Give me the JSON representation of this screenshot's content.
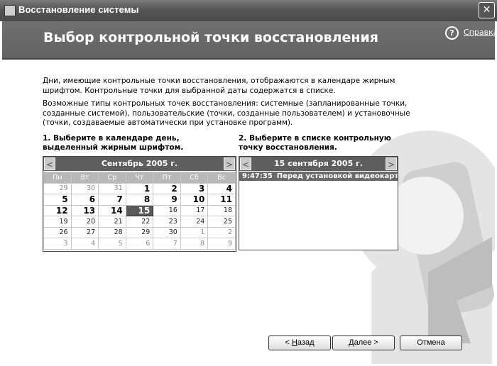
{
  "window": {
    "title": "Восстановление системы",
    "close_glyph": "✕"
  },
  "header": {
    "heading": "Выбор контрольной точки восстановления",
    "help_glyph": "?",
    "help_link": "Справка"
  },
  "intro": {
    "para1": "Дни, имеющие контрольные точки восстановления, отображаются в календаре жирным шрифтом. Контрольные точки для выбранной даты содержатся в списке.",
    "para2": "Возможные типы контрольных точек восстановления: системные (запланированные точки, созданные системой), пользовательские (точки, созданные пользователем) и установочные (точки, создаваемые автоматически при установке программ)."
  },
  "steps": {
    "step1": "1. Выберите в календаре день, выделенный жирным шрифтом.",
    "step2": "2. Выберите в списке контрольную точку восстановления."
  },
  "calendar": {
    "month_label": "Сентябрь 2005 г.",
    "prev_glyph": "<",
    "next_glyph": ">",
    "weekdays": [
      "Пн",
      "Вт",
      "Ср",
      "Чт",
      "Пт",
      "Сб",
      "Вс"
    ],
    "selected_day": "15",
    "weeks": [
      [
        {
          "d": "29",
          "t": "other"
        },
        {
          "d": "30",
          "t": "other"
        },
        {
          "d": "31",
          "t": "other"
        },
        {
          "d": "1",
          "t": "bold"
        },
        {
          "d": "2",
          "t": "bold"
        },
        {
          "d": "3",
          "t": "bold"
        },
        {
          "d": "4",
          "t": "bold"
        }
      ],
      [
        {
          "d": "5",
          "t": "bold"
        },
        {
          "d": "6",
          "t": "bold"
        },
        {
          "d": "7",
          "t": "bold"
        },
        {
          "d": "8",
          "t": "bold"
        },
        {
          "d": "9",
          "t": "bold"
        },
        {
          "d": "10",
          "t": "bold"
        },
        {
          "d": "11",
          "t": "bold"
        }
      ],
      [
        {
          "d": "12",
          "t": "bold"
        },
        {
          "d": "13",
          "t": "bold"
        },
        {
          "d": "14",
          "t": "bold"
        },
        {
          "d": "15",
          "t": "selected"
        },
        {
          "d": "16",
          "t": "normal"
        },
        {
          "d": "17",
          "t": "normal"
        },
        {
          "d": "18",
          "t": "normal"
        }
      ],
      [
        {
          "d": "19",
          "t": "normal"
        },
        {
          "d": "20",
          "t": "normal"
        },
        {
          "d": "21",
          "t": "normal"
        },
        {
          "d": "22",
          "t": "normal"
        },
        {
          "d": "23",
          "t": "normal"
        },
        {
          "d": "24",
          "t": "normal"
        },
        {
          "d": "25",
          "t": "normal"
        }
      ],
      [
        {
          "d": "26",
          "t": "normal"
        },
        {
          "d": "27",
          "t": "normal"
        },
        {
          "d": "28",
          "t": "normal"
        },
        {
          "d": "29",
          "t": "normal"
        },
        {
          "d": "30",
          "t": "normal"
        },
        {
          "d": "1",
          "t": "other"
        },
        {
          "d": "2",
          "t": "other"
        }
      ],
      [
        {
          "d": "3",
          "t": "other"
        },
        {
          "d": "4",
          "t": "other"
        },
        {
          "d": "5",
          "t": "other"
        },
        {
          "d": "6",
          "t": "other"
        },
        {
          "d": "7",
          "t": "other"
        },
        {
          "d": "8",
          "t": "other"
        },
        {
          "d": "9",
          "t": "other"
        }
      ]
    ]
  },
  "restore_list": {
    "date_label": "15 сентября 2005 г.",
    "prev_glyph": "<",
    "next_glyph": ">",
    "items": [
      {
        "time": "9:47:35",
        "description": "Перед установкой видеокарты"
      }
    ]
  },
  "buttons": {
    "back": "< Назад",
    "next": "Далее >",
    "cancel": "Отмена"
  },
  "colors": {
    "title_bar": "#555555",
    "header_band": "#666666",
    "selected_day": "#5a5a5a",
    "list_selected": "#6a6a6a"
  },
  "icons": {
    "window": "system-restore-icon",
    "help": "help-circle-icon",
    "decoration": "clock-restore-illustration"
  }
}
